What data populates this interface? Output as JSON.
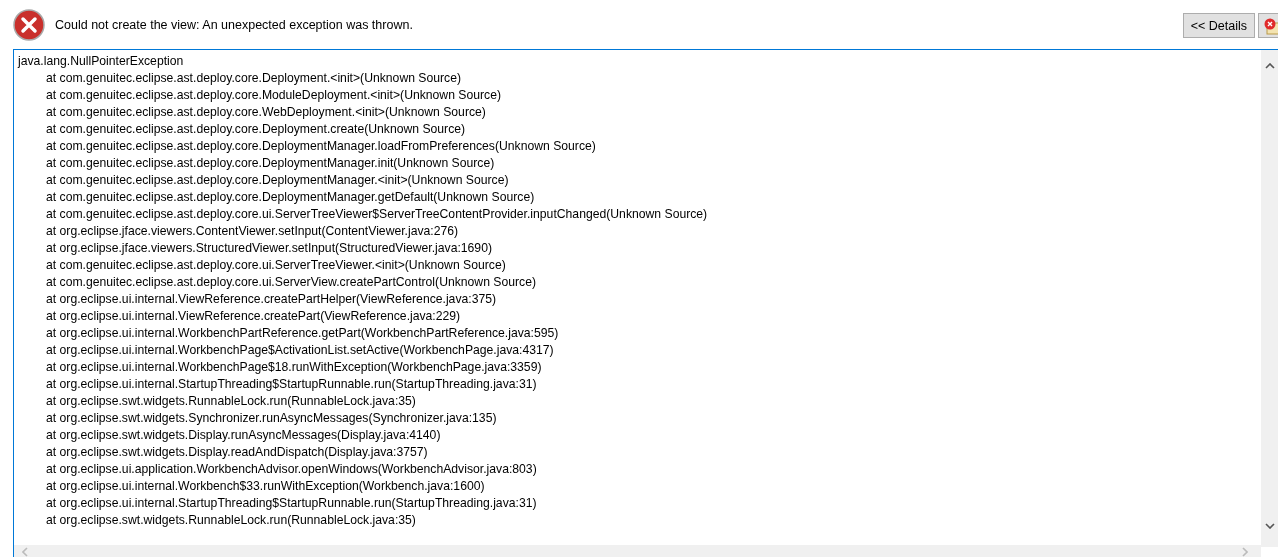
{
  "message": "Could not create the view: An unexpected exception was thrown.",
  "buttons": [
    {
      "label": "<< Details",
      "kind": "text"
    },
    {
      "kind": "icon"
    }
  ],
  "trace": {
    "exception": "java.lang.NullPointerException",
    "frames": [
      "at com.genuitec.eclipse.ast.deploy.core.Deployment.<init>(Unknown Source)",
      "at com.genuitec.eclipse.ast.deploy.core.ModuleDeployment.<init>(Unknown Source)",
      "at com.genuitec.eclipse.ast.deploy.core.WebDeployment.<init>(Unknown Source)",
      "at com.genuitec.eclipse.ast.deploy.core.Deployment.create(Unknown Source)",
      "at com.genuitec.eclipse.ast.deploy.core.DeploymentManager.loadFromPreferences(Unknown Source)",
      "at com.genuitec.eclipse.ast.deploy.core.DeploymentManager.init(Unknown Source)",
      "at com.genuitec.eclipse.ast.deploy.core.DeploymentManager.<init>(Unknown Source)",
      "at com.genuitec.eclipse.ast.deploy.core.DeploymentManager.getDefault(Unknown Source)",
      "at com.genuitec.eclipse.ast.deploy.core.ui.ServerTreeViewer$ServerTreeContentProvider.inputChanged(Unknown Source)",
      "at org.eclipse.jface.viewers.ContentViewer.setInput(ContentViewer.java:276)",
      "at org.eclipse.jface.viewers.StructuredViewer.setInput(StructuredViewer.java:1690)",
      "at com.genuitec.eclipse.ast.deploy.core.ui.ServerTreeViewer.<init>(Unknown Source)",
      "at com.genuitec.eclipse.ast.deploy.core.ui.ServerView.createPartControl(Unknown Source)",
      "at org.eclipse.ui.internal.ViewReference.createPartHelper(ViewReference.java:375)",
      "at org.eclipse.ui.internal.ViewReference.createPart(ViewReference.java:229)",
      "at org.eclipse.ui.internal.WorkbenchPartReference.getPart(WorkbenchPartReference.java:595)",
      "at org.eclipse.ui.internal.WorkbenchPage$ActivationList.setActive(WorkbenchPage.java:4317)",
      "at org.eclipse.ui.internal.WorkbenchPage$18.runWithException(WorkbenchPage.java:3359)",
      "at org.eclipse.ui.internal.StartupThreading$StartupRunnable.run(StartupThreading.java:31)",
      "at org.eclipse.swt.widgets.RunnableLock.run(RunnableLock.java:35)",
      "at org.eclipse.swt.widgets.Synchronizer.runAsyncMessages(Synchronizer.java:135)",
      "at org.eclipse.swt.widgets.Display.runAsyncMessages(Display.java:4140)",
      "at org.eclipse.swt.widgets.Display.readAndDispatch(Display.java:3757)",
      "at org.eclipse.ui.application.WorkbenchAdvisor.openWindows(WorkbenchAdvisor.java:803)",
      "at org.eclipse.ui.internal.Workbench$33.runWithException(Workbench.java:1600)",
      "at org.eclipse.ui.internal.StartupThreading$StartupRunnable.run(StartupThreading.java:31)",
      "at org.eclipse.swt.widgets.RunnableLock.run(RunnableLock.java:35)"
    ]
  }
}
